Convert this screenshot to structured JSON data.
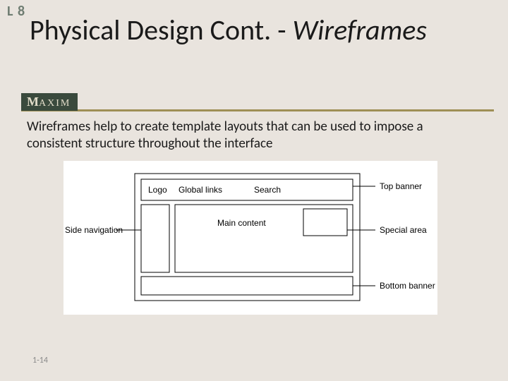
{
  "tag": "L 8",
  "title_main": "Physical Design Cont. - ",
  "title_ital": "Wireframes",
  "brand": "AXIM",
  "brand_prefix": "M",
  "paragraph": "Wireframes help to create template layouts that can be used to impose a consistent structure throughout the interface",
  "wireframe": {
    "top_logo": "Logo",
    "top_links": "Global links",
    "top_search": "Search",
    "main": "Main content",
    "label_top": "Top banner",
    "label_side": "Side navigation",
    "label_special": "Special area",
    "label_bottom": "Bottom banner"
  },
  "footer": "1-14"
}
